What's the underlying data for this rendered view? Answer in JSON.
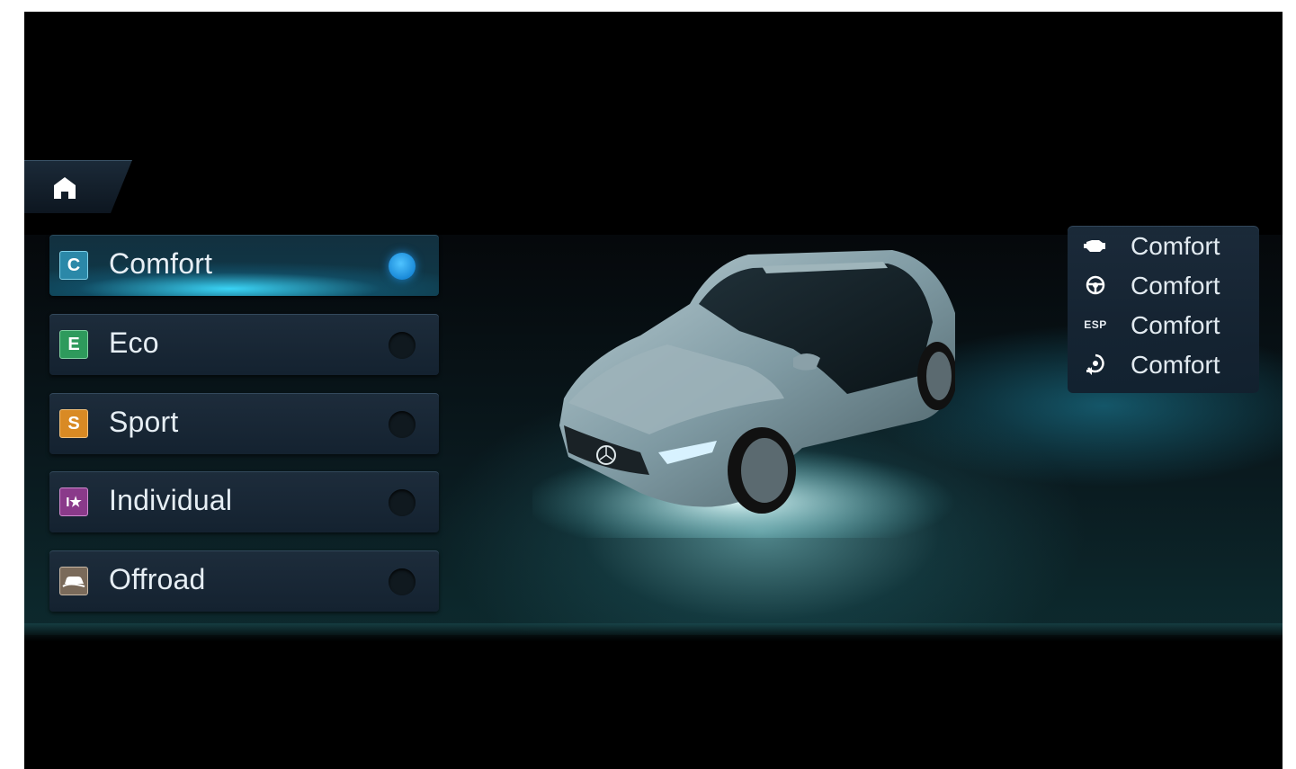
{
  "modes": [
    {
      "badge": "C",
      "label": "Comfort",
      "color": "#2b88a8",
      "selected": true
    },
    {
      "badge": "E",
      "label": "Eco",
      "color": "#2e9a5c",
      "selected": false
    },
    {
      "badge": "S",
      "label": "Sport",
      "color": "#d98a24",
      "selected": false
    },
    {
      "badge": "I★",
      "label": "Individual",
      "color": "#8a3a8a",
      "selected": false
    },
    {
      "badge": "",
      "label": "Offroad",
      "color": "#7a6a5a",
      "selected": false
    }
  ],
  "status": {
    "engine": {
      "icon": "engine-icon",
      "value": "Comfort"
    },
    "steering": {
      "icon": "steering-wheel-icon",
      "value": "Comfort"
    },
    "esp": {
      "icon": "esp-icon",
      "label": "ESP",
      "value": "Comfort"
    },
    "sound": {
      "icon": "engine-sound-icon",
      "value": "Comfort"
    }
  },
  "colors": {
    "accent": "#1a8ad8",
    "background": "#000000",
    "panel": "#1d2c3b"
  }
}
